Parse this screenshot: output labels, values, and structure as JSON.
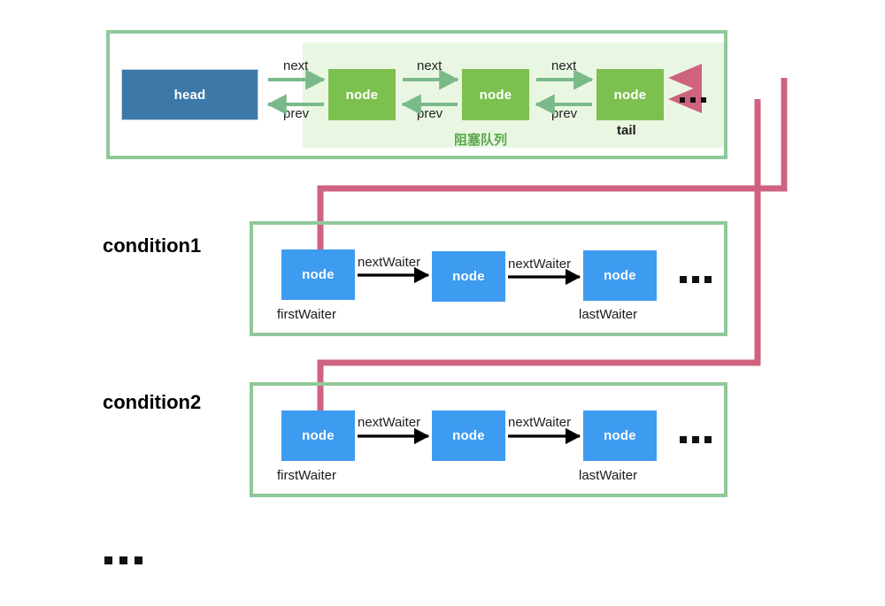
{
  "diagram": {
    "title": "AQS condition queues diagram",
    "colors": {
      "green_frame": "#90c89a",
      "queue_tint": "#e9f7e2",
      "node_green": "#7cc04f",
      "node_blue": "#3d9bf0",
      "head_blue": "#3d79a8",
      "pink_link": "#cf637f",
      "green_arrow": "#7ab98a",
      "black_arrow": "#000000",
      "cn_label_green": "#5aa64a"
    },
    "sync_queue": {
      "head_label": "head",
      "chinese_label": "阻塞队列",
      "tail_caption": "tail",
      "nodes": [
        {
          "label": "node"
        },
        {
          "label": "node"
        },
        {
          "label": "node"
        }
      ],
      "edges": [
        {
          "forward": "next",
          "backward": "prev"
        },
        {
          "forward": "next",
          "backward": "prev"
        },
        {
          "forward": "next",
          "backward": "prev"
        }
      ],
      "trailing_ellipsis": "..."
    },
    "conditions": [
      {
        "title": "condition1",
        "nodes": [
          {
            "label": "node",
            "caption": "firstWaiter"
          },
          {
            "label": "node",
            "caption": ""
          },
          {
            "label": "node",
            "caption": "lastWaiter"
          }
        ],
        "edges": [
          {
            "label": "nextWaiter"
          },
          {
            "label": "nextWaiter"
          }
        ],
        "trailing_ellipsis": "..."
      },
      {
        "title": "condition2",
        "nodes": [
          {
            "label": "node",
            "caption": "firstWaiter"
          },
          {
            "label": "node",
            "caption": ""
          },
          {
            "label": "node",
            "caption": "lastWaiter"
          }
        ],
        "edges": [
          {
            "label": "nextWaiter"
          },
          {
            "label": "nextWaiter"
          }
        ],
        "trailing_ellipsis": "..."
      }
    ],
    "more_conditions_ellipsis": "..."
  }
}
